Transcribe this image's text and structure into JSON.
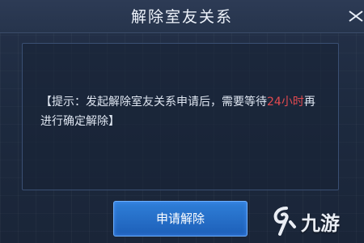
{
  "dialog": {
    "title": "解除室友关系",
    "notice_prefix": "【提示：发起解除室友关系申请后，需要等待",
    "notice_highlight": "24小时",
    "notice_suffix": "再进行确定解除】",
    "confirm_label": "申请解除",
    "highlight_color": "#e34a50",
    "accent_color": "#2f7fd8"
  },
  "watermark": {
    "text": "九游",
    "icon": "jiuyou-logo-icon"
  }
}
